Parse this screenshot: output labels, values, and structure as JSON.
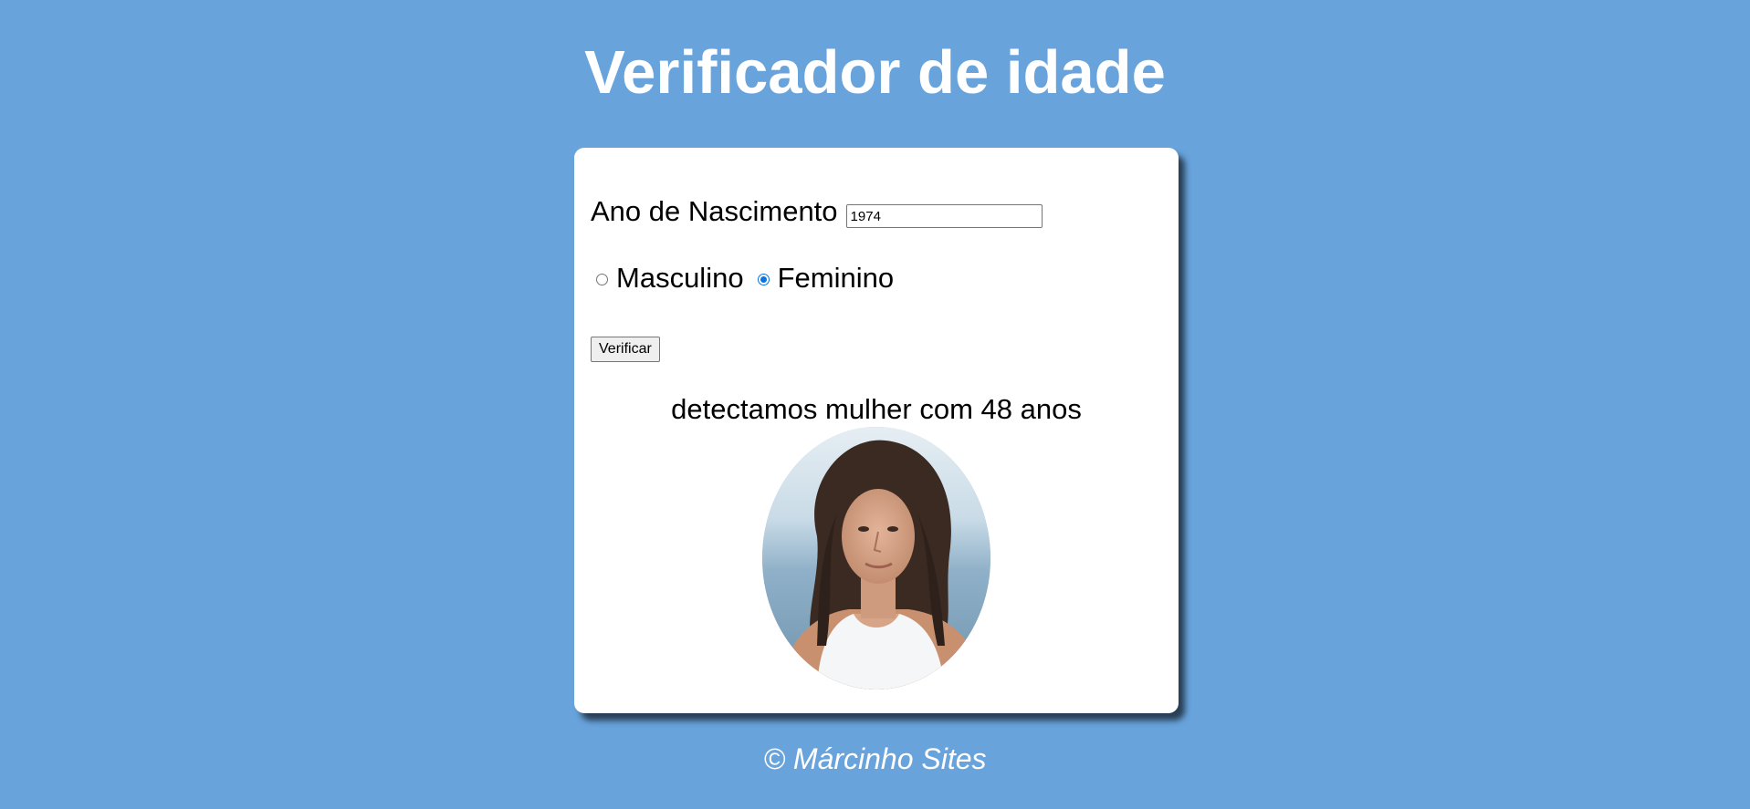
{
  "page": {
    "title": "Verificador de idade",
    "footer": "© Márcinho Sites"
  },
  "form": {
    "year_label": "Ano de Nascimento",
    "year_value": "1974",
    "sex_options": [
      {
        "label": "Masculino",
        "checked": false
      },
      {
        "label": "Feminino",
        "checked": true
      }
    ],
    "submit_label": "Verificar"
  },
  "result": {
    "text": "detectamos mulher com 48 anos",
    "photo": "woman-portrait"
  },
  "colors": {
    "background": "#68a3dc",
    "card": "#ffffff",
    "radio_accent": "#0b75dd"
  }
}
